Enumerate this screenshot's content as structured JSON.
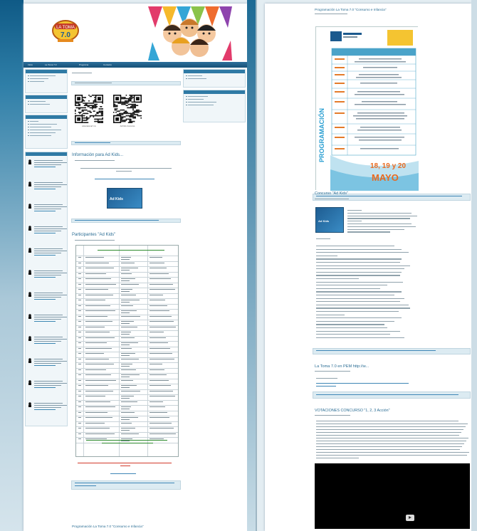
{
  "site": {
    "nav": [
      "Inicio",
      "La Toma 7.0",
      "Programa",
      "Contacto"
    ]
  },
  "left_sidebar": {
    "widget_titles": [
      "Categorías",
      "Archivos",
      "Etiquetas",
      "Twitter"
    ]
  },
  "right_sidebar": {
    "widget_titles": [
      "Archivos",
      "Enlaces"
    ]
  },
  "posts": {
    "qr_caption_left": "www.latoma7.mx",
    "qr_caption_right": "Ad Kids Concurso",
    "ad_kids_title": "Información para Ad Kids...",
    "participantes_title": "Participantes \"Ad Kids\"",
    "programacion_title_bottom": "Programación La Toma 7.0 \"Consumo e Infancia\"",
    "programacion_title_top": "Programación La Toma 7.0 \"Consumo e Infancia\"",
    "concurso_title": "Concurso \"Ad Kids\"",
    "pem_title": "La Toma 7.0 en PEM http://w...",
    "votaciones_title": "VOTACIONES CONCURSO \"1, 2, 3 Acción\"",
    "poster_month": "MAYO",
    "poster_days": "18, 19 y 20",
    "poster_side": "PROGRAMACIÓN",
    "adkids_logo": "Ad Kids"
  },
  "colors": {
    "accent": "#2a6d94",
    "nav": "#175178",
    "green_note": "#2e8b2e",
    "red_note": "#d23a2a"
  }
}
